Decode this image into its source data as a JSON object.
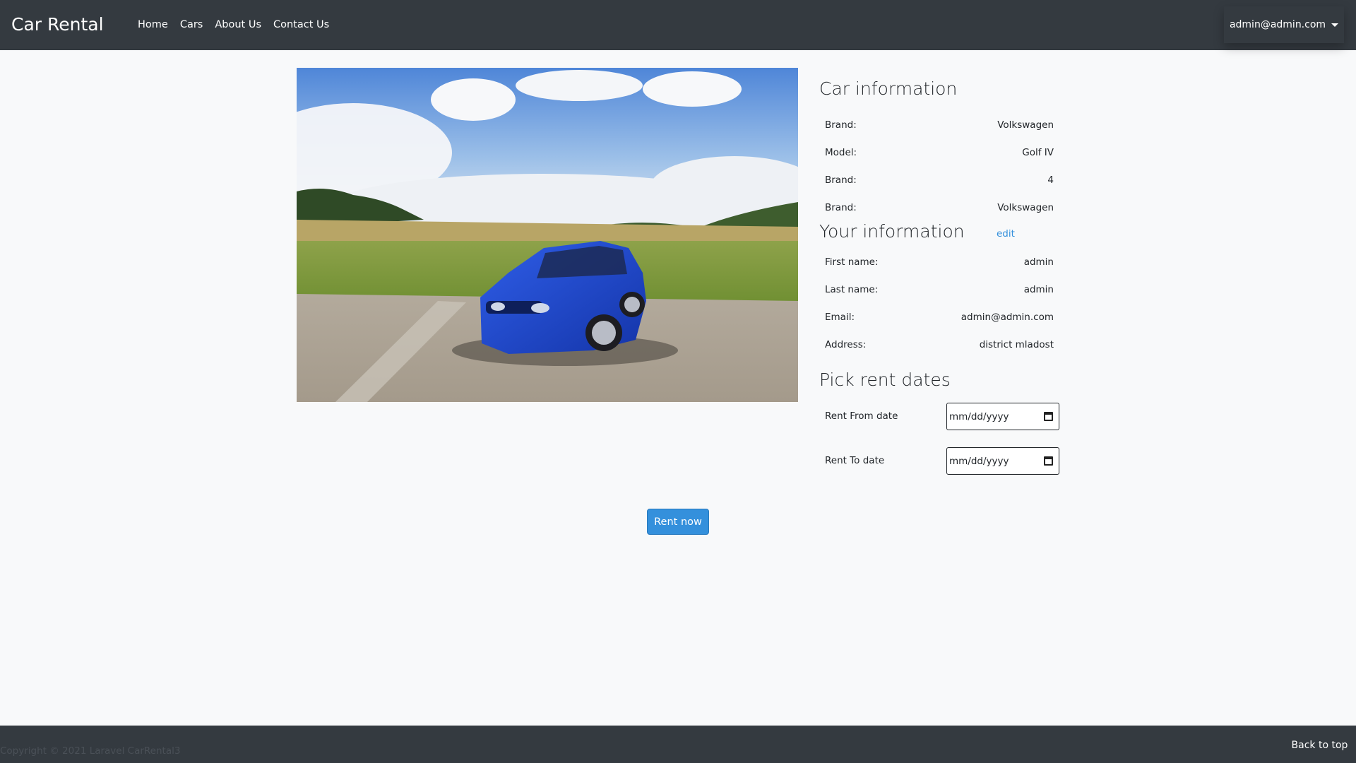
{
  "navbar": {
    "brand": "Car Rental",
    "links": [
      "Home",
      "Cars",
      "About Us",
      "Contact Us"
    ],
    "user": "admin@admin.com"
  },
  "car_image": {
    "alt": "blue-volkswagen-golf-icon"
  },
  "car_info": {
    "title": "Car information",
    "rows": [
      {
        "label": "Brand:",
        "value": "Volkswagen"
      },
      {
        "label": "Model:",
        "value": "Golf IV"
      },
      {
        "label": "Brand:",
        "value": "4"
      },
      {
        "label": "Brand:",
        "value": "Volkswagen"
      }
    ]
  },
  "user_info": {
    "title": "Your information",
    "edit_label": "edit",
    "rows": [
      {
        "label": "First name:",
        "value": "admin"
      },
      {
        "label": "Last name:",
        "value": "admin"
      },
      {
        "label": "Email:",
        "value": "admin@admin.com"
      },
      {
        "label": "Address:",
        "value": "district mladost"
      }
    ]
  },
  "rent_dates": {
    "title": "Pick rent dates",
    "from_label": "Rent From date",
    "to_label": "Rent To date",
    "date_placeholder": "mm/dd/yyyy"
  },
  "actions": {
    "rent_label": "Rent now"
  },
  "footer": {
    "copyright": "Copyright © 2021 Laravel CarRental3",
    "back_to_top": "Back to top"
  },
  "colors": {
    "navbar": "#343a40",
    "accent": "#3490dc",
    "background": "#f8f9fa"
  }
}
